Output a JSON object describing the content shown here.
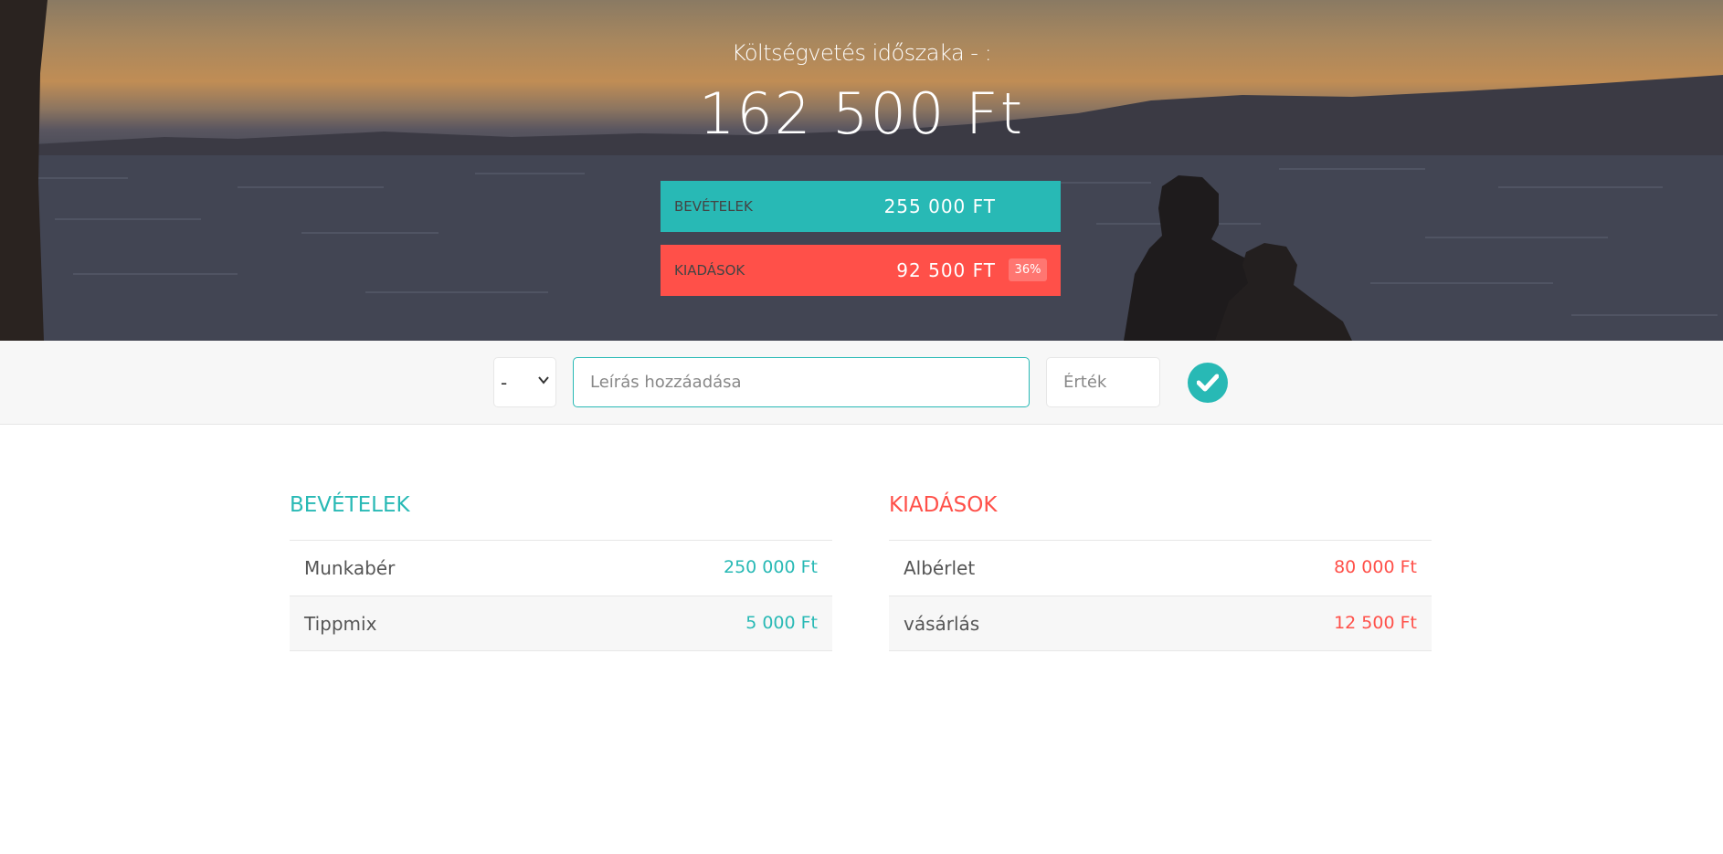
{
  "budget": {
    "title": "Költségvetés időszaka - :",
    "value": "162 500 Ft"
  },
  "summary": {
    "income": {
      "label": "Bevételek",
      "value": "255 000 Ft"
    },
    "expenses": {
      "label": "Kiadások",
      "value": "92 500 Ft",
      "percentage": "36%"
    }
  },
  "add_form": {
    "type_selected": "-",
    "description_placeholder": "Leírás hozzáadása",
    "value_placeholder": "Érték",
    "submit_icon": "checkmark-circle-icon"
  },
  "income_list": {
    "title": "Bevételek",
    "items": [
      {
        "description": "Munkabér",
        "value": "250 000 Ft"
      },
      {
        "description": "Tippmix",
        "value": "5 000 Ft"
      }
    ]
  },
  "expense_list": {
    "title": "Kiadások",
    "items": [
      {
        "description": "Albérlet",
        "value": "80 000 Ft"
      },
      {
        "description": "vásárlás",
        "value": "12 500 Ft"
      }
    ]
  },
  "colors": {
    "income_accent": "#28b9b5",
    "expense_accent": "#ff5049"
  }
}
